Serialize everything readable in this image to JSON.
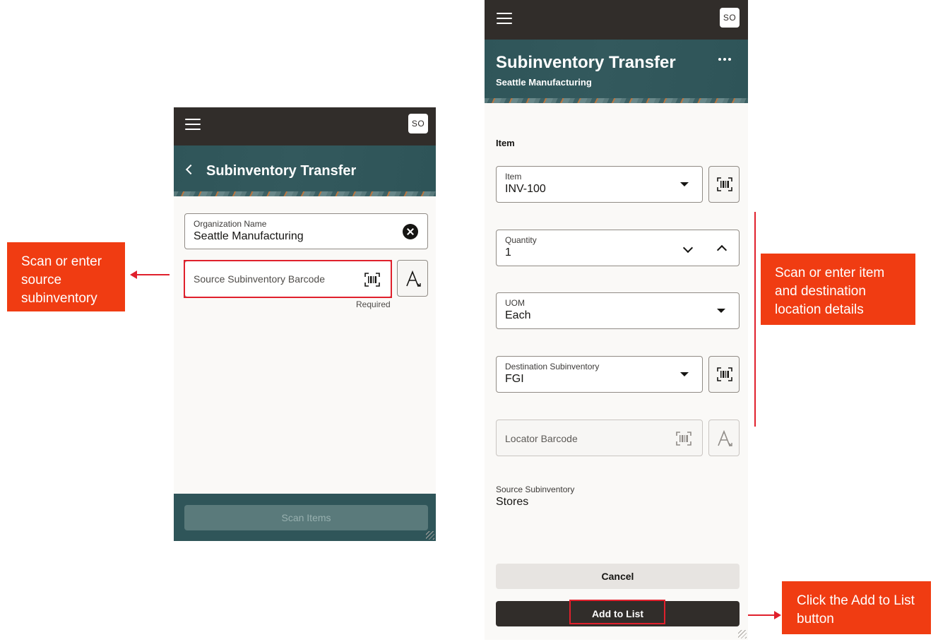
{
  "colors": {
    "topbar": "#312d2a",
    "header": "#2f5559",
    "callout": "#f03c12",
    "highlight": "#e0202c"
  },
  "left_screen": {
    "avatar": "SO",
    "title": "Subinventory Transfer",
    "organization": {
      "label": "Organization Name",
      "value": "Seattle Manufacturing"
    },
    "source_barcode": {
      "placeholder": "Source Subinventory Barcode",
      "helper": "Required"
    },
    "scan_items_label": "Scan Items"
  },
  "right_screen": {
    "avatar": "SO",
    "title": "Subinventory Transfer",
    "subtitle": "Seattle Manufacturing",
    "section_label": "Item",
    "item": {
      "label": "Item",
      "value": "INV-100"
    },
    "quantity": {
      "label": "Quantity",
      "value": "1"
    },
    "uom": {
      "label": "UOM",
      "value": "Each"
    },
    "destination": {
      "label": "Destination Subinventory",
      "value": "FGI"
    },
    "locator": {
      "placeholder": "Locator Barcode"
    },
    "source_subinventory": {
      "label": "Source Subinventory",
      "value": "Stores"
    },
    "cancel_label": "Cancel",
    "add_label": "Add to List"
  },
  "callouts": {
    "source": "Scan or enter source subinventory",
    "item_details": "Scan or enter item and destination location details",
    "add_button": "Click the Add to List button"
  },
  "icons": [
    "menu-icon",
    "back-chevron-icon",
    "clear-icon",
    "barcode-icon",
    "font-icon",
    "dropdown-caret-icon",
    "chevron-down-icon",
    "chevron-up-icon",
    "more-icon"
  ]
}
